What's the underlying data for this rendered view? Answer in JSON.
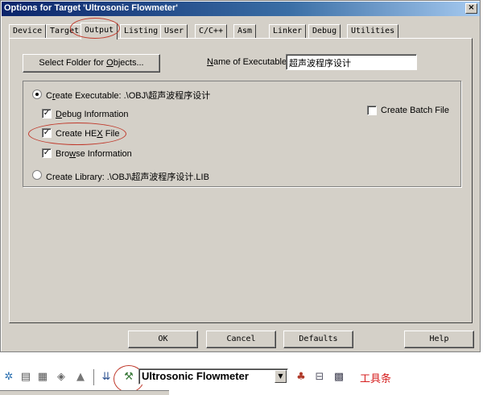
{
  "window": {
    "title": "Options for Target 'Ultrosonic Flowmeter'",
    "close_glyph": "×"
  },
  "tabs": [
    {
      "label": "Device"
    },
    {
      "label": "Target"
    },
    {
      "label": "Output"
    },
    {
      "label": "Listing"
    },
    {
      "label": "User"
    },
    {
      "label": "C/C++"
    },
    {
      "label": "Asm"
    },
    {
      "label": "Linker"
    },
    {
      "label": "Debug"
    },
    {
      "label": "Utilities"
    }
  ],
  "active_tab": "Output",
  "output": {
    "select_folder_pre": "Select Folder for ",
    "select_folder_key": "O",
    "select_folder_post": "bjects...",
    "name_label_key": "N",
    "name_label_rest": "ame of Executable:",
    "name_value": "超声波程序设计",
    "create_exe_pre": "C",
    "create_exe_key": "r",
    "create_exe_post": "eate Executable:  .\\OBJ\\超声波程序设计",
    "create_exe_selected": true,
    "debug_info_key": "D",
    "debug_info_rest": "ebug Information",
    "debug_info_checked": true,
    "hex_pre": "Create HE",
    "hex_key": "X",
    "hex_post": " File",
    "hex_checked": true,
    "browse_pre": "Bro",
    "browse_key": "w",
    "browse_post": "se Information",
    "browse_checked": true,
    "batch_label": "Create Batch File",
    "batch_checked": false,
    "create_lib_label": "Create Library:  .\\OBJ\\超声波程序设计.LIB",
    "create_lib_selected": false,
    "check_glyph": "✓"
  },
  "buttons": {
    "ok": "OK",
    "cancel": "Cancel",
    "defaults": "Defaults",
    "help": "Help"
  },
  "toolbar": {
    "icons": [
      "translate-icon",
      "build-icon",
      "rebuild-all-icon",
      "batch-build-icon",
      "stop-build-icon",
      "load-flash-icon",
      "target-options-icon"
    ],
    "target_name": "Ultrosonic Flowmeter",
    "dropdown_glyph": "▼",
    "trailing_icons": [
      "select-device-icon",
      "manage-components-icon",
      "configure-tools-icon"
    ],
    "annotation": "工具条"
  },
  "colors": {
    "dialog_face": "#d4d0c8",
    "title_start": "#0a246a",
    "title_end": "#a6caf0",
    "annotation_red": "#d62020",
    "ring_red": "#c0392b"
  }
}
